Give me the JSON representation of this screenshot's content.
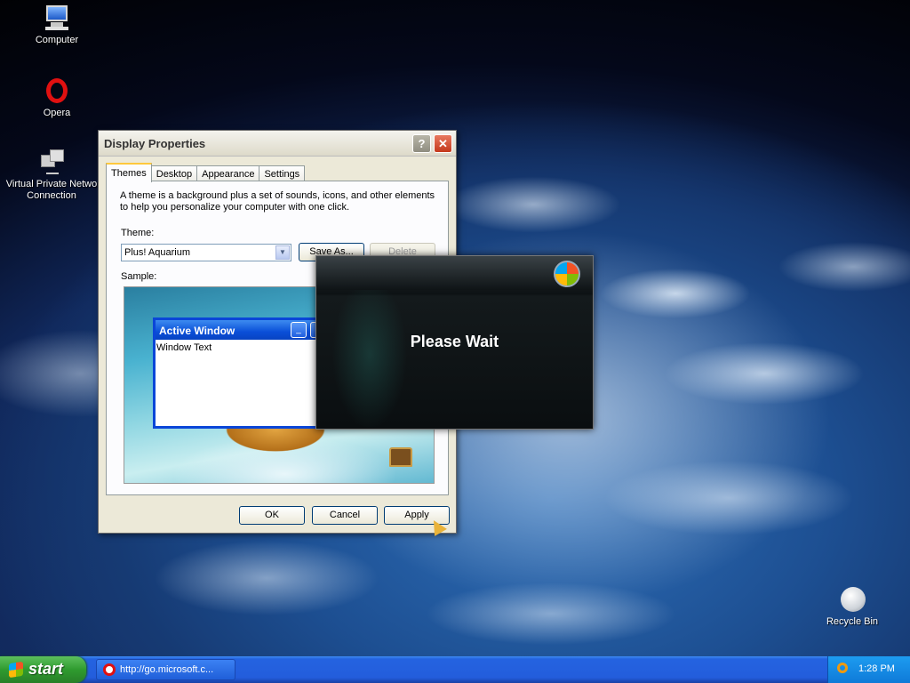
{
  "desktop": {
    "icons": [
      {
        "label": "Computer",
        "icon": "computer-icon"
      },
      {
        "label": "Opera",
        "icon": "opera-icon"
      },
      {
        "label": "Virtual Private Netwo Connection",
        "icon": "network-connection-icon"
      },
      {
        "label": "Recycle Bin",
        "icon": "recycle-bin-icon"
      }
    ]
  },
  "display_properties": {
    "title": "Display Properties",
    "help_glyph": "?",
    "close_glyph": "✕",
    "tabs": [
      "Themes",
      "Desktop",
      "Appearance",
      "Settings"
    ],
    "active_tab": "Themes",
    "description": "A theme is a background plus a set of sounds, icons, and other elements to help you personalize your computer with one click.",
    "theme_label": "Theme:",
    "theme_value": "Plus! Aquarium",
    "save_as_label": "Save As...",
    "delete_label": "Delete",
    "sample_label": "Sample:",
    "sample": {
      "active_window_title": "Active Window",
      "window_text": "Window Text",
      "minimize_glyph": "_",
      "maximize_glyph": "□"
    },
    "ok_label": "OK",
    "cancel_label": "Cancel",
    "apply_label": "Apply"
  },
  "please_wait": {
    "message": "Please Wait"
  },
  "taskbar": {
    "start_label": "start",
    "task_label": "http://go.microsoft.c...",
    "clock": "1:28 PM"
  },
  "colors": {
    "xp_blue": "#245edc",
    "start_green": "#2f9b2f",
    "tab_highlight": "#ffc83c"
  }
}
